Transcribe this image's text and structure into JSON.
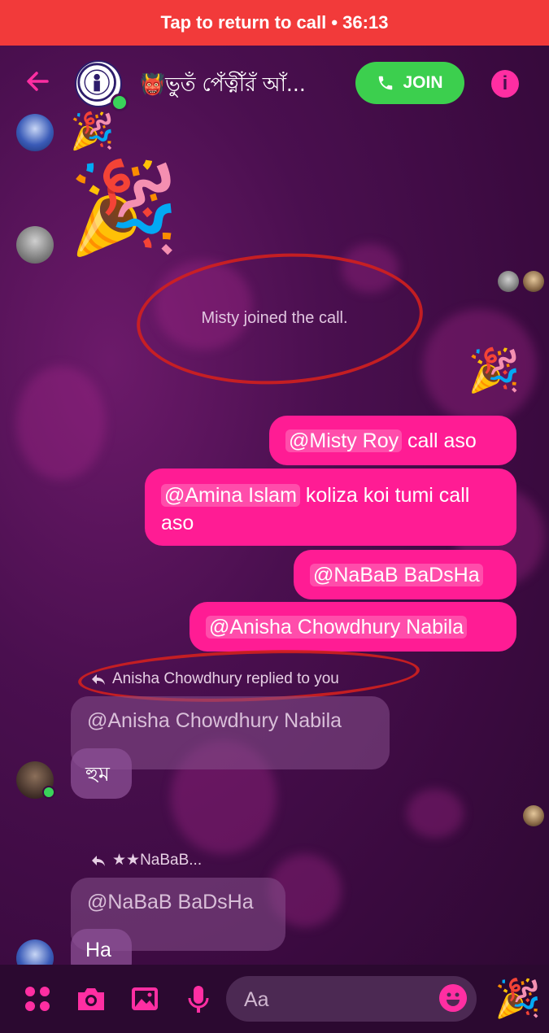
{
  "call_banner": {
    "text": "Tap to return to call • 36:13"
  },
  "header": {
    "group_name": "👹ভুুতঁ পেঁত্নীঁরঁ আঁ...",
    "join_label": "JOIN",
    "info_label": "i"
  },
  "system": {
    "joined_text": "Misty joined the call."
  },
  "emojis": {
    "party": "🎉"
  },
  "outgoing_messages": [
    {
      "mention": "@Misty Roy",
      "text": " call aso"
    },
    {
      "mention": "@Amina Islam",
      "text": " koliza koi tumi call aso"
    },
    {
      "mention": "@NaBaB BaDsHa",
      "text": ""
    },
    {
      "mention": "@Anisha Chowdhury Nabila",
      "text": ""
    }
  ],
  "replies": [
    {
      "label": "Anisha Chowdhury replied to you",
      "quoted": "@Anisha Chowdhury Nabila",
      "text": "হুম"
    },
    {
      "label": "★★NaBaB...",
      "quoted": "@NaBaB BaDsHa",
      "text": "Ha"
    }
  ],
  "composer": {
    "placeholder": "Aa"
  },
  "colors": {
    "accent": "#ff1c94",
    "banner": "#f23a3a",
    "join": "#3ccf4e"
  }
}
